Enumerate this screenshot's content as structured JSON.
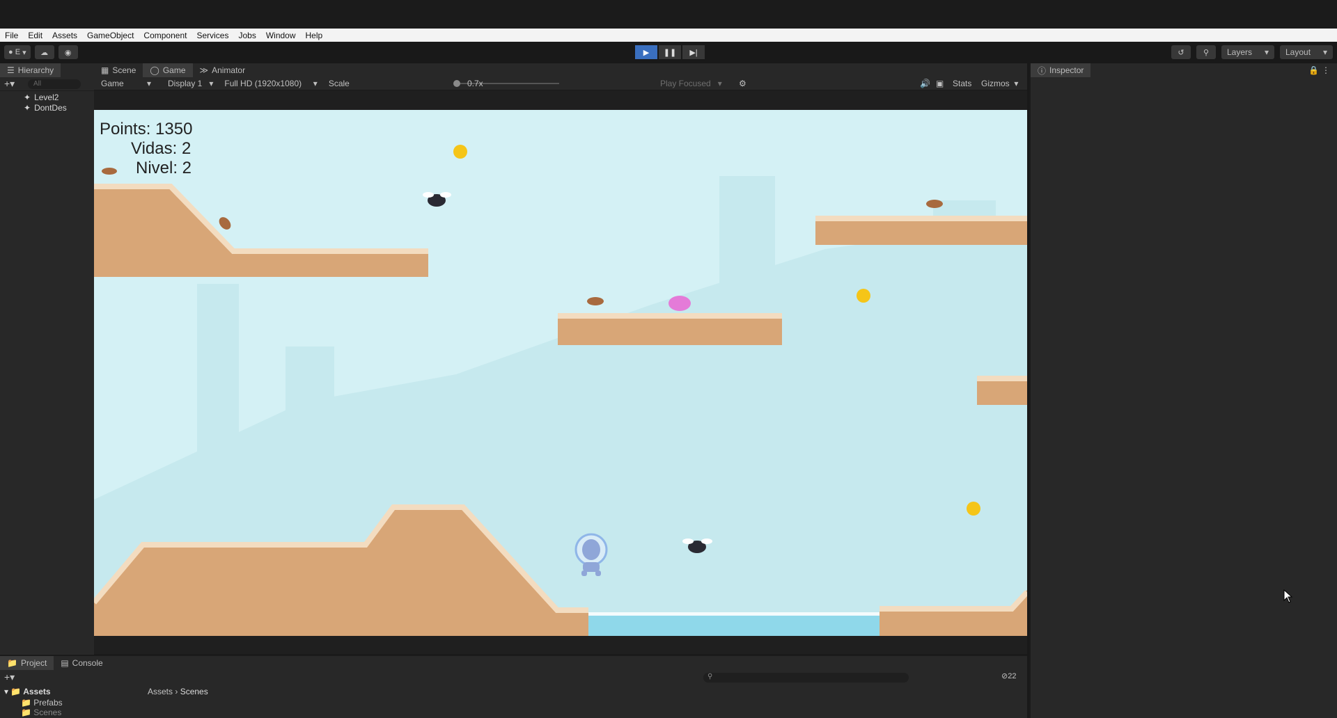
{
  "menu": [
    "File",
    "Edit",
    "Assets",
    "GameObject",
    "Component",
    "Services",
    "Jobs",
    "Window",
    "Help"
  ],
  "toolbar": {
    "account_label": "E",
    "layers_label": "Layers",
    "layout_label": "Layout"
  },
  "hierarchy": {
    "tab_label": "Hierarchy",
    "search_placeholder": "All",
    "items": [
      "Level2",
      "DontDes"
    ]
  },
  "center_tabs": [
    "Scene",
    "Game",
    "Animator"
  ],
  "game_header": {
    "mode": "Game",
    "display": "Display 1",
    "resolution": "Full HD (1920x1080)",
    "scale_label": "Scale",
    "scale_value": "0.7x",
    "play_focused": "Play Focused",
    "stats": "Stats",
    "gizmos": "Gizmos"
  },
  "hud": {
    "points": "Points: 1350",
    "vidas": "Vidas: 2",
    "nivel": "Nivel: 2"
  },
  "inspector": {
    "tab_label": "Inspector"
  },
  "bottom": {
    "tabs": [
      "Project",
      "Console"
    ],
    "tree": [
      "Assets",
      "Prefabs",
      "Scenes"
    ],
    "breadcrumb": [
      "Assets",
      "Scenes"
    ],
    "hidden_count": "22"
  },
  "colors": {
    "sky": "#d4f1f5",
    "ground": "#d8a677",
    "ground_top": "#f3dcc0",
    "water": "#8fd8ea",
    "accent": "#3a6fbf"
  }
}
